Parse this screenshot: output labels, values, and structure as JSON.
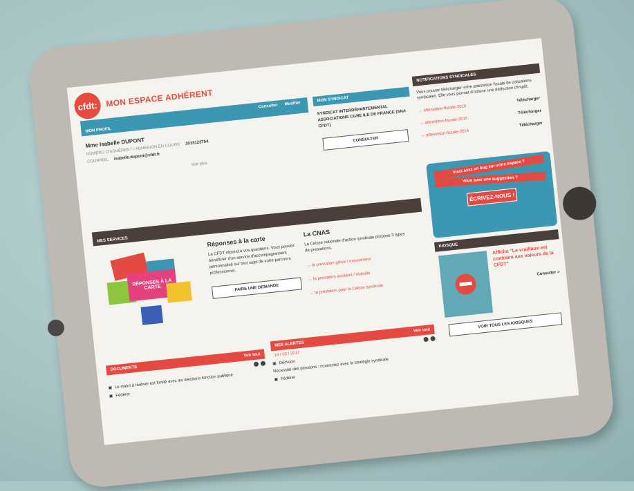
{
  "header": {
    "logo_text": "cfdt:",
    "title": "MON ESPACE ADHÉRENT"
  },
  "profile": {
    "tab_label": "MON PROFIL",
    "actions": [
      "Consulter",
      "Modifier"
    ],
    "name": "Mme Isabelle DUPONT",
    "member_label": "NUMÉRO D'ADHÉRENT / ADHÉSION EN COURS",
    "member_number": "2013123754",
    "email_label": "COURRIEL",
    "email": "isabelle.dupont@cfdt.fr",
    "more_link": "Voir plus"
  },
  "union": {
    "bar_label": "MON SYNDICAT",
    "name": "SYNDICAT INTERDÉPARTEMENTAL ASSOCIATIONS CGRE ILE DE FRANCE (SNA CFDT)",
    "button": "CONSULTER"
  },
  "notifications": {
    "bar_label": "NOTIFICATIONS SYNDICALES",
    "intro": "Vous pouvez télécharger votre attestation fiscale de cotisations syndicales. Elle vous permet d'obtenir une déduction d'impôt.",
    "items": [
      {
        "link": "→ attestation-fiscale-2016",
        "action": "Télécharger"
      },
      {
        "link": "→ attestation-fiscale-2015",
        "action": "Télécharger"
      },
      {
        "link": "→ attestation-fiscale-2014",
        "action": "Télécharger"
      }
    ]
  },
  "news": {
    "bar_label": "MES SERVICES",
    "image_text": "RÉPONSES À LA CARTE",
    "col1_title": "Réponses à la carte",
    "col1_text": "La CFDT répond à vos questions. Vous pouvez bénéficier d'un service d'accompagnement personnalisé sur tout sujet de votre parcours professionnel.",
    "col1_button": "FAIRE UNE DEMANDE",
    "col2_title": "La CNAS",
    "col2_text": "La Caisse nationale d'action syndicale propose 3 types de prestations.",
    "col2_links": [
      "→ la prestation grève / mouvement",
      "→ la prestation accident / maladie",
      "→ la prestation pour la Caisse syndicale"
    ]
  },
  "promo": {
    "line1": "Vous avez un bug sur votre espace ?",
    "line2": "Vous avez une suggestion ?",
    "cta": "ÉCRIVEZ-NOUS !"
  },
  "kiosk": {
    "bar_label": "KIOSQUE",
    "article": "Affiche \"Le vrai/faux est contraire aux valeurs de la CFDT\"",
    "more": "Consulter >",
    "button": "VOIR TOUS LES KIOSQUES"
  },
  "docs": {
    "bar_label": "DOCUMENTS",
    "bar_action": "Voir tout",
    "rows": [
      "Le statut à réaliser est fondé avec les élections fonction publique",
      "Fédérer"
    ]
  },
  "alerts": {
    "bar_label": "MES ALERTES",
    "bar_action": "Voir tout",
    "date": "14 / 03 / 2017",
    "rows": [
      "Décision",
      "Nécessité des pensions : connectez avec la stratégie syndicale",
      "Fédérer"
    ]
  }
}
